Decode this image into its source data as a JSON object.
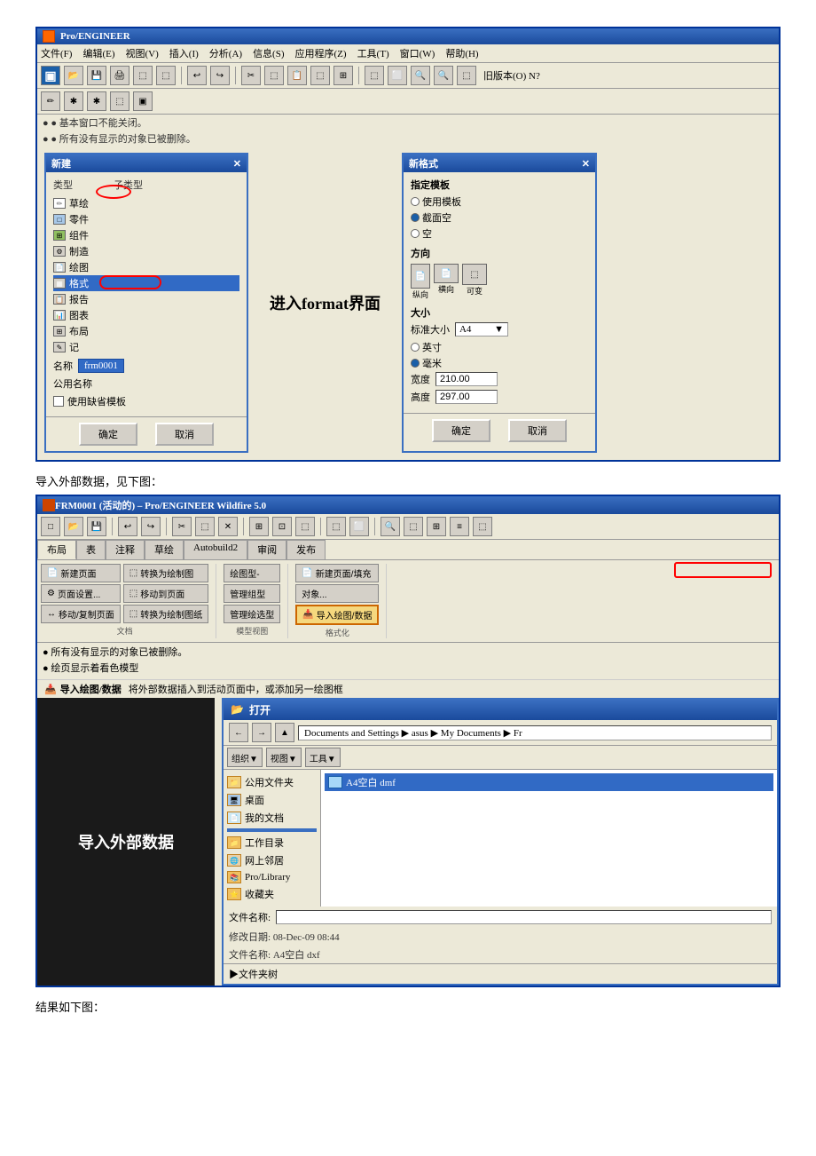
{
  "page": {
    "bg": "#ffffff"
  },
  "first_screenshot": {
    "title": "Pro/ENGINEER",
    "menubar": [
      "文件(F)",
      "编辑(E)",
      "视图(V)",
      "插入(I)",
      "分析(A)",
      "信息(S)",
      "应用程序(Z)",
      "工具(T)",
      "窗口(W)",
      "帮助(H)"
    ],
    "toolbar_note": "旧版本(O) N?",
    "status_lines": [
      "● 基本窗口不能关闭。",
      "● 所有没有显示的对象已被删除。"
    ],
    "new_dialog": {
      "title": "新建",
      "type_label": "类型",
      "subtype_label": "子类型",
      "items": [
        "草绘",
        "零件",
        "组件",
        "制造",
        "绘图",
        "格式",
        "报告",
        "图表",
        "布局",
        "记"
      ],
      "selected_item": "格式",
      "name_label": "名称",
      "name_value": "frm0001",
      "common_name_label": "公用名称",
      "use_template_label": "使用缺省模板",
      "ok_btn": "确定",
      "cancel_btn": "取消"
    },
    "new_format_dialog": {
      "title": "新格式",
      "specify_template_label": "指定模板",
      "use_template_opt": "使用模板",
      "empty_opt": "截面空",
      "empty_opt2": "空",
      "direction_label": "方向",
      "template_icons": [
        "纵向",
        "横向",
        "可变"
      ],
      "size_label": "大小",
      "standard_size_label": "标准大小",
      "standard_size_value": "A4",
      "inch_opt": "英寸",
      "mm_opt": "毫米",
      "width_label": "宽度",
      "width_value": "210.00",
      "height_label": "高度",
      "height_value": "297.00",
      "ok_btn": "确定",
      "cancel_btn": "取消"
    },
    "annotation": "进入format界面"
  },
  "section_text_1": "导入外部数据，见下图：",
  "second_screenshot": {
    "title": "FRM0001 (活动的) – Pro/ENGINEER Wildfire 5.0",
    "tabs": [
      "布局",
      "表",
      "注释",
      "草绘",
      "Autobuild2",
      "审阅",
      "发布"
    ],
    "ribbon_groups": {
      "document": {
        "btns": [
          "新建页面",
          "页面设置...",
          "移动/复制页面"
        ],
        "group_btns": [
          "转换为绘制图",
          "移动到页面",
          "转换为绘制图纸"
        ]
      },
      "model": {
        "btns": [
          "绘图型-",
          "管理组型",
          "管理绘选型"
        ]
      },
      "format": {
        "btns": [
          "新建页面/填充",
          "对象..."
        ],
        "highlighted_btn": "导入绘图/数据"
      }
    },
    "status_notes": [
      "● 所有没有显示的对象已被删除。",
      "● 绘页显示着看色模型"
    ],
    "import_label": "导入外部数据",
    "tooltip_text": "导入绘图/数据",
    "tooltip_desc": "将外部数据插入到活动页面中，或添加另一绘图框",
    "file_dialog": {
      "title": "打开",
      "path": "Documents and Settings ▶ asus ▶ My Documents ▶ Fr",
      "nav_items": [
        "公用文件夹",
        "桌面",
        "我的文档",
        "工作目录",
        "网上邻居",
        "Pro/Library",
        "收藏夹"
      ],
      "file_items": [
        "A4空白 dmf"
      ],
      "selected_file": "A4空白 dmf",
      "file_name_label": "文件名称:",
      "file_name_value": "A4空白 dxf",
      "file_date_label": "修改日期:",
      "file_date_value": "08-Dec-09 08:44",
      "file_name_label2": "文件名称:",
      "file_name_value2": "A4空白 dxf",
      "file_tree_label": "▶文件夹树"
    }
  },
  "section_text_2": "结果如下图："
}
